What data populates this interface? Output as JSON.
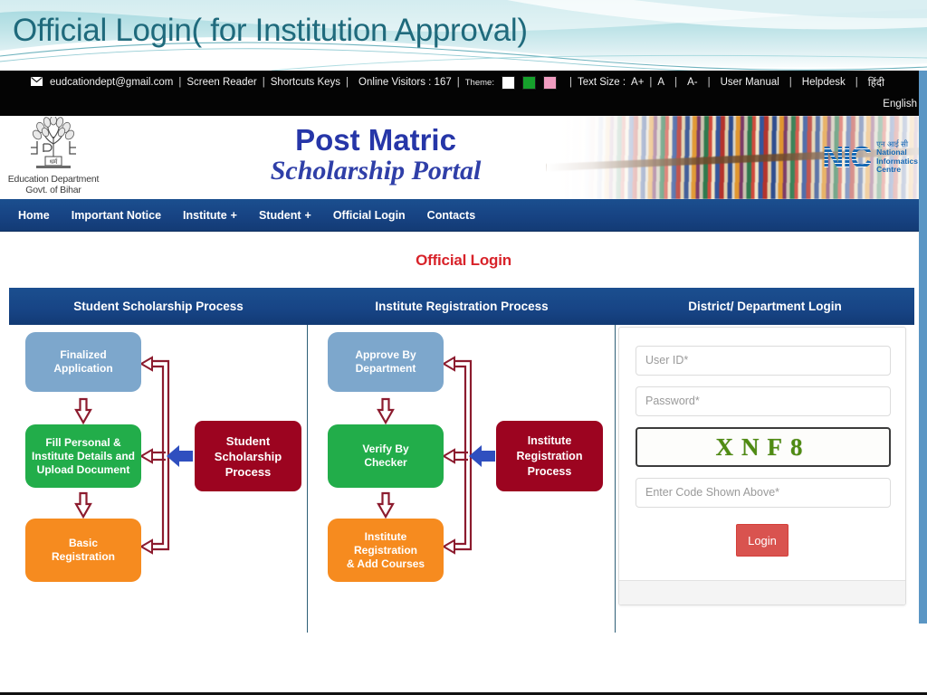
{
  "slide": {
    "title": "Official Login( for Institution Approval)"
  },
  "utility_bar": {
    "email": "eudcationdept@gmail.com",
    "mail_icon": "envelope-icon",
    "screen_reader": "Screen Reader",
    "shortcut_keys": "Shortcuts Keys",
    "online_visitors": "Online Visitors : 167",
    "theme_label": "Theme:",
    "theme_swatches": [
      {
        "name": "theme-white",
        "color": "#ffffff"
      },
      {
        "name": "theme-green",
        "color": "#16a02c"
      },
      {
        "name": "theme-pink",
        "color": "#f09cc0"
      }
    ],
    "text_size_label": "Text Size :",
    "text_size_plus": "A+",
    "text_size_normal": "A",
    "text_size_minus": "A-",
    "user_manual": "User Manual",
    "helpdesk": "Helpdesk",
    "lang_hindi": "हिंदी",
    "lang_english": "English",
    "sep": "|"
  },
  "banner": {
    "emblem_line1": "Education Department",
    "emblem_line2": "Govt. of Bihar",
    "emblem_icon": "bihar-government-emblem-icon",
    "title_line1": "Post Matric",
    "title_line2": "Scholarship Portal",
    "nic_mark": "NIC",
    "nic_hindi": "एन आई सी",
    "nic_line1": "National",
    "nic_line2": "Informatics",
    "nic_line3": "Centre",
    "books_image": "library-bookshelf-photo"
  },
  "nav": {
    "items": [
      {
        "label": "Home",
        "has_plus": false
      },
      {
        "label": "Important Notice",
        "has_plus": false
      },
      {
        "label": "Institute",
        "has_plus": true
      },
      {
        "label": "Student",
        "has_plus": true
      },
      {
        "label": "Official Login",
        "has_plus": false
      },
      {
        "label": "Contacts",
        "has_plus": false
      }
    ],
    "plus": "+"
  },
  "page": {
    "heading": "Official Login",
    "columns": [
      {
        "header": "Student Scholarship Process"
      },
      {
        "header": "Institute Registration Process"
      },
      {
        "header": "District/ Department Login"
      }
    ]
  },
  "flow_student": {
    "top": "Finalized\nApplication",
    "top_l1": "Finalized",
    "top_l2": "Application",
    "mid_l1": "Fill Personal &",
    "mid_l2": "Institute Details and",
    "mid_l3": "Upload Document",
    "bot_l1": "Basic",
    "bot_l2": "Registration",
    "side_l1": "Student",
    "side_l2": "Scholarship",
    "side_l3": "Process",
    "colors": {
      "top": "#7da7cc",
      "mid": "#22ad4a",
      "bot": "#f68b1f",
      "side": "#9c0420",
      "arrow_outline": "#8c1b2e",
      "arrow_blue": "#2f4fbf"
    }
  },
  "flow_institute": {
    "top_l1": "Approve By",
    "top_l2": "Department",
    "mid_l1": "Verify By",
    "mid_l2": "Checker",
    "bot_l1": "Institute",
    "bot_l2": "Registration",
    "bot_l3": "& Add Courses",
    "side_l1": "Institute",
    "side_l2": "Registration",
    "side_l3": "Process",
    "colors": {
      "top": "#7da7cc",
      "mid": "#22ad4a",
      "bot": "#f68b1f",
      "side": "#9c0420"
    }
  },
  "login": {
    "user_id_placeholder": "User ID*",
    "user_id_value": "",
    "password_placeholder": "Password*",
    "password_value": "",
    "captcha_text": "XNF8",
    "captcha_color": "#4f8b12",
    "code_placeholder": "Enter Code Shown Above*",
    "code_value": "",
    "login_label": "Login",
    "login_color": "#d9534f"
  }
}
